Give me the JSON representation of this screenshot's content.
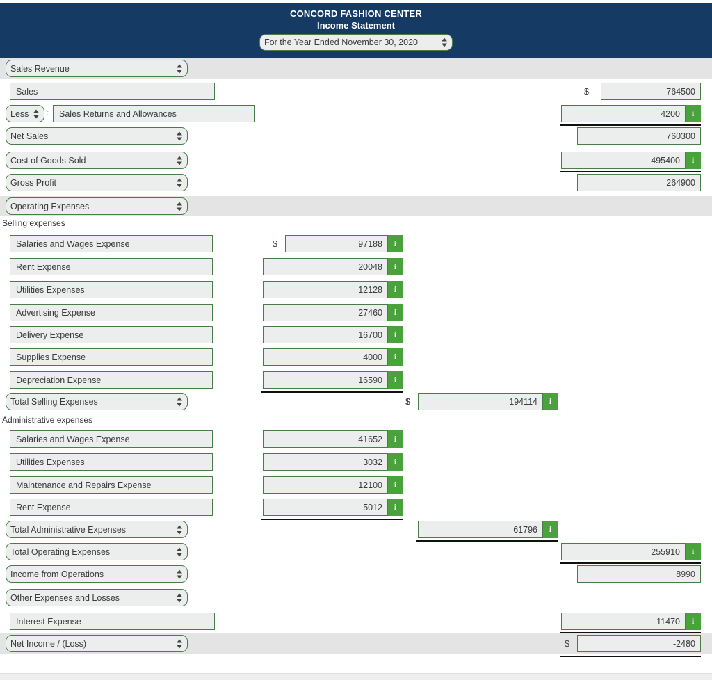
{
  "header": {
    "company": "CONCORD FASHION CENTER",
    "title": "Income Statement",
    "period": "For the Year Ended November 30, 2020",
    "bg_color": "#153a63"
  },
  "colors": {
    "header_navy": "#153a63",
    "control_border_green": "#4a7c4a",
    "badge_green": "#4aa23c",
    "control_fill": "#eceded",
    "band_grey": "#e4e4e4"
  },
  "icons": {
    "spinner": "up-down-spinner-icon",
    "info_badge": "i"
  },
  "sections": {
    "sales_revenue": "Sales Revenue",
    "operating_expenses": "Operating Expenses",
    "other_expenses": "Other Expenses and Losses",
    "selling_expenses_heading": "Selling expenses",
    "administrative_expenses_heading": "Administrative expenses"
  },
  "symbols": {
    "dollar": "$",
    "colon": ":"
  },
  "rows": {
    "sales": {
      "label": "Sales",
      "value": "764500",
      "dollar": "$"
    },
    "less_prefix": "Less",
    "sales_returns": {
      "label": "Sales Returns and Allowances",
      "value": "4200"
    },
    "net_sales": {
      "label": "Net Sales",
      "value": "760300"
    },
    "cogs": {
      "label": "Cost of Goods Sold",
      "value": "495400"
    },
    "gross_profit": {
      "label": "Gross Profit",
      "value": "264900"
    },
    "selling": [
      {
        "label": "Salaries and Wages Expense",
        "value": "97188",
        "dollar": "$"
      },
      {
        "label": "Rent Expense",
        "value": "20048"
      },
      {
        "label": "Utilities Expenses",
        "value": "12128"
      },
      {
        "label": "Advertising Expense",
        "value": "27460"
      },
      {
        "label": "Delivery Expense",
        "value": "16700"
      },
      {
        "label": "Supplies Expense",
        "value": "4000"
      },
      {
        "label": "Depreciation Expense",
        "value": "16590"
      }
    ],
    "total_selling": {
      "label": "Total Selling Expenses",
      "value": "194114",
      "dollar": "$"
    },
    "admin": [
      {
        "label": "Salaries and Wages Expense",
        "value": "41652"
      },
      {
        "label": "Utilities Expenses",
        "value": "3032"
      },
      {
        "label": "Maintenance and Repairs Expense",
        "value": "12100"
      },
      {
        "label": "Rent Expense",
        "value": "5012"
      }
    ],
    "total_admin": {
      "label": "Total Administrative Expenses",
      "value": "61796"
    },
    "total_operating": {
      "label": "Total Operating Expenses",
      "value": "255910"
    },
    "income_from_ops": {
      "label": "Income from Operations",
      "value": "8990"
    },
    "interest_expense": {
      "label": "Interest Expense",
      "value": "11470"
    },
    "net_income": {
      "label": "Net Income / (Loss)",
      "value": "-2480",
      "dollar": "$"
    }
  }
}
